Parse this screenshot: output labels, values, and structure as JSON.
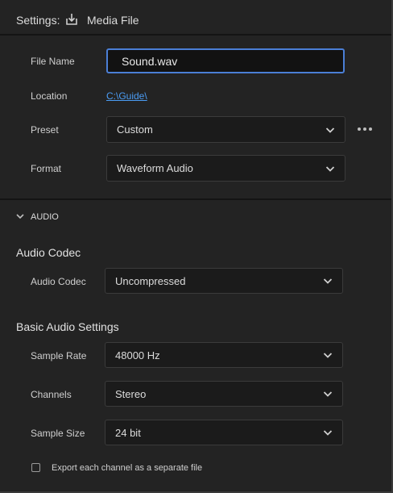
{
  "header": {
    "title": "Settings:",
    "media_label": "Media File"
  },
  "file": {
    "name_label": "File Name",
    "name_value": "Sound.wav",
    "location_label": "Location",
    "location_value": "C:\\Guide\\",
    "preset_label": "Preset",
    "preset_value": "Custom",
    "format_label": "Format",
    "format_value": "Waveform Audio"
  },
  "audio": {
    "section_label": "AUDIO",
    "codec_heading": "Audio Codec",
    "codec_label": "Audio Codec",
    "codec_value": "Uncompressed",
    "basic_heading": "Basic Audio Settings",
    "sample_rate_label": "Sample Rate",
    "sample_rate_value": "48000 Hz",
    "channels_label": "Channels",
    "channels_value": "Stereo",
    "sample_size_label": "Sample Size",
    "sample_size_value": "24 bit",
    "export_channels_label": "Export each channel as a separate file",
    "export_channels_checked": false
  },
  "colors": {
    "accent": "#4b7fd6",
    "link": "#4b9df5",
    "background": "#232323"
  }
}
